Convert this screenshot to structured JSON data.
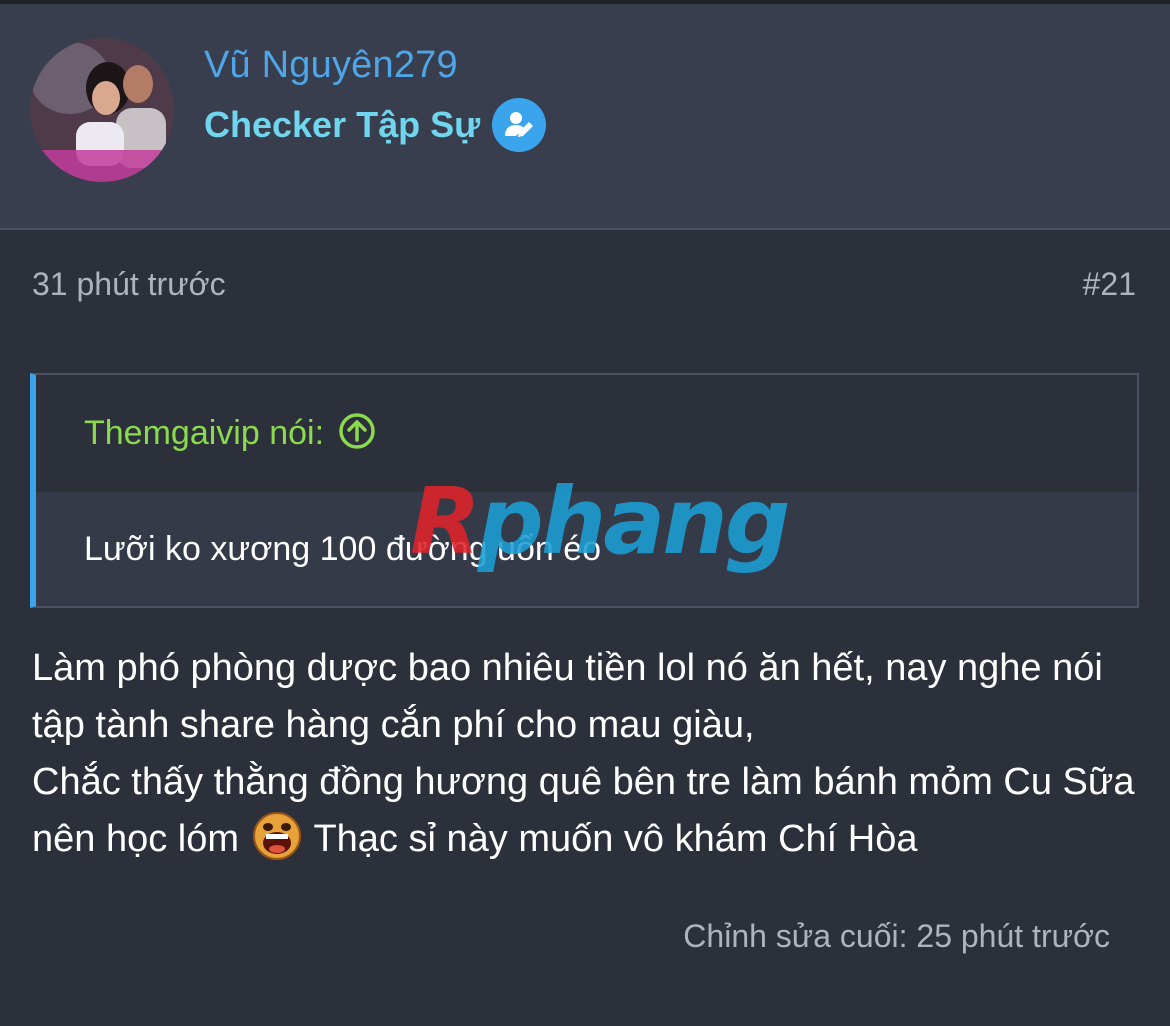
{
  "user": {
    "name": "Vũ Nguyên279",
    "role": "Checker Tập Sự",
    "role_icon": "user-edit-icon"
  },
  "post": {
    "time": "31 phút trước",
    "number": "#21",
    "quote": {
      "author_label": "Themgaivip nói:",
      "author_icon": "arrow-up-circle-icon",
      "text": "Lưỡi ko xương 100 đường uốn éo"
    },
    "message": {
      "line1": "Làm phó phòng dược bao nhiêu tiền lol nó ăn hết, nay nghe nói tập tành share hàng cắn phí cho mau giàu,",
      "line2": "Chắc thấy thằng đồng hương quê bên tre làm bánh mỏm Cu Sữa nên học lóm",
      "line2_emoji": "screaming-face-emoji",
      "line2_after": "Thạc sỉ này muốn vô khám Chí Hòa"
    },
    "edited": "Chỉnh sửa cuối: 25 phút trước"
  },
  "watermark": {
    "first": "R",
    "rest": "phang"
  },
  "colors": {
    "background": "#2c303b",
    "header": "#383e4d",
    "username": "#4ea5e8",
    "role": "#6fd6ee",
    "quote_author": "#8bd94d",
    "quote_border": "#3aa5ec"
  }
}
